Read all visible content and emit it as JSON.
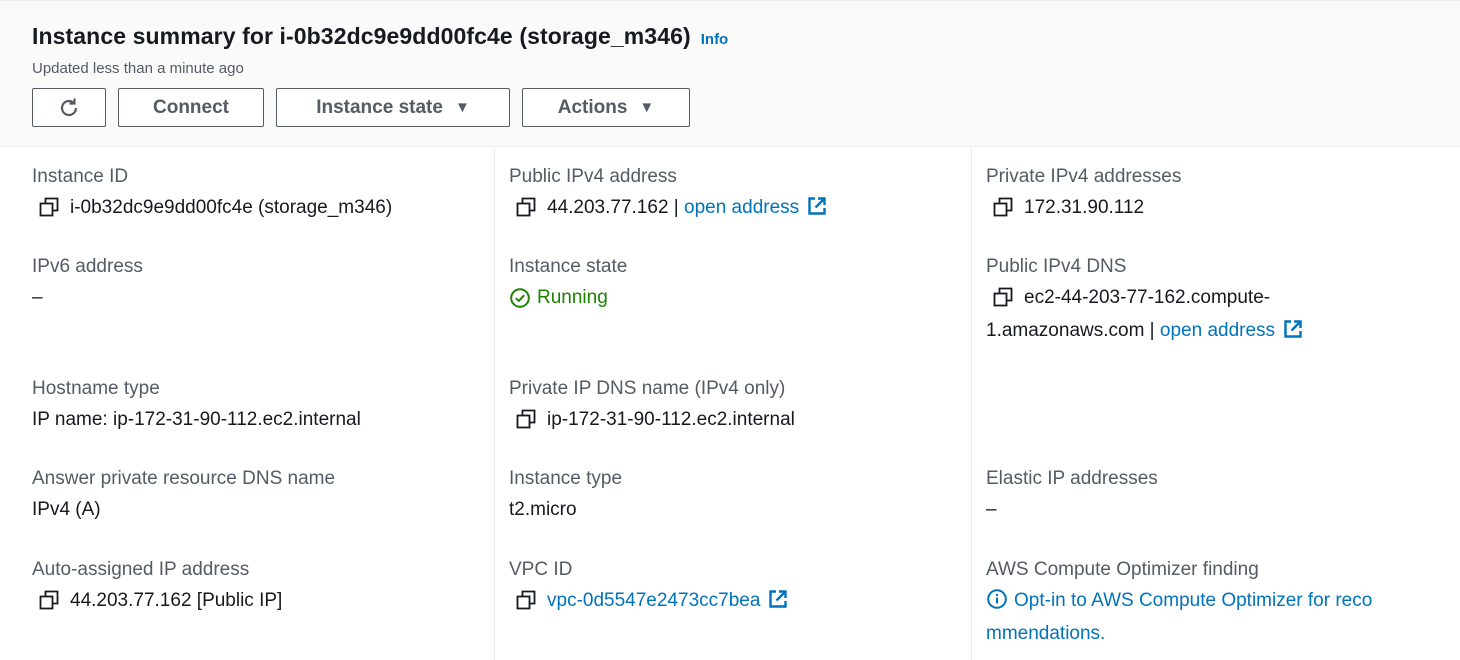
{
  "header": {
    "title": "Instance summary for i-0b32dc9e9dd00fc4e (storage_m346)",
    "info_label": "Info",
    "updated": "Updated less than a minute ago",
    "buttons": {
      "connect": "Connect",
      "instance_state": "Instance state",
      "actions": "Actions"
    }
  },
  "fields": {
    "instance_id": {
      "label": "Instance ID",
      "value": "i-0b32dc9e9dd00fc4e (storage_m346)"
    },
    "public_ipv4": {
      "label": "Public IPv4 address",
      "value": "44.203.77.162",
      "sep": " | ",
      "link": "open address"
    },
    "private_ipv4": {
      "label": "Private IPv4 addresses",
      "value": "172.31.90.112"
    },
    "ipv6": {
      "label": "IPv6 address",
      "value": "–"
    },
    "instance_state": {
      "label": "Instance state",
      "value": "Running"
    },
    "public_dns": {
      "label": "Public IPv4 DNS",
      "value_line1": "ec2-44-203-77-162.compute-",
      "value_line2": "1.amazonaws.com",
      "sep": " | ",
      "link": "open address"
    },
    "hostname_type": {
      "label": "Hostname type",
      "value": "IP name: ip-172-31-90-112.ec2.internal"
    },
    "private_dns": {
      "label": "Private IP DNS name (IPv4 only)",
      "value": "ip-172-31-90-112.ec2.internal"
    },
    "answer_dns": {
      "label": "Answer private resource DNS name",
      "value": "IPv4 (A)"
    },
    "instance_type": {
      "label": "Instance type",
      "value": "t2.micro"
    },
    "elastic_ip": {
      "label": "Elastic IP addresses",
      "value": "–"
    },
    "auto_ip": {
      "label": "Auto-assigned IP address",
      "value": "44.203.77.162 [Public IP]"
    },
    "vpc_id": {
      "label": "VPC ID",
      "value": "vpc-0d5547e2473cc7bea"
    },
    "optimizer": {
      "label": "AWS Compute Optimizer finding",
      "line1": "Opt-in to AWS Compute Optimizer for reco",
      "line2": "mmendations."
    }
  },
  "colors": {
    "link": "#0073bb",
    "running": "#1d8102",
    "label": "#545b64",
    "text": "#16191f"
  },
  "icons": [
    "refresh-icon",
    "caret-down-icon",
    "copy-icon",
    "external-link-icon",
    "check-circle-icon",
    "info-circle-icon"
  ]
}
